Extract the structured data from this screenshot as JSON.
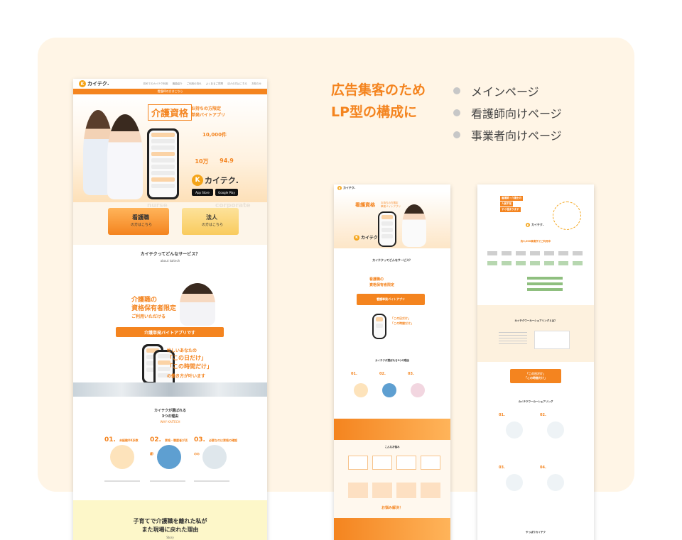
{
  "colors": {
    "accent": "#f4841f",
    "panel_bg": "#fff5e6",
    "bullet": "#c7c7c7"
  },
  "heading": {
    "line1": "広告集客のため",
    "line2": "LP型の構成に"
  },
  "bullets": [
    "メインページ",
    "看護師向けページ",
    "事業者向けページ"
  ],
  "main": {
    "logo": "カイテク.",
    "nav": [
      "初めてのカイテク利用",
      "機能紹介",
      "ご利用の流れ",
      "よくあるご質問",
      "法人の方はこちら",
      "お知らせ"
    ],
    "banner": "看護師の方はこちら",
    "hero_title": "介護資格",
    "hero_sub1": "お持ちの方限定",
    "hero_sub2": "単発バイトアプリ",
    "stat1_value": "10,000件",
    "stat2_value": "10万",
    "stat3_value": "94.9",
    "logo_big": "カイテク.",
    "store1": "App Store",
    "store2": "Google Play",
    "btn_nurse_title": "看護職",
    "btn_nurse_sub": "の方はこちら",
    "btn_nurse_bg": "nurse",
    "btn_corp_title": "法人",
    "btn_corp_sub": "の方はこちら",
    "btn_corp_bg": "corporate",
    "about_title": "カイテクってどんなサービス？",
    "about_en": "about kaitech",
    "about_line1": "介護職の",
    "about_line2": "資格保有者限定",
    "about_line3": "ご利用いただける",
    "about_bar": "介護単発バイトアプリです",
    "busy_line1": "忙しいあなたの",
    "busy_line2": "「この日だけ」",
    "busy_line3": "「この時間だけ」",
    "busy_line4": "の働き方が叶います",
    "reasons_title1": "カイテクが選ばれる",
    "reasons_title2": "3つの理由",
    "reasons_en": "WHY KAITECH",
    "reasons": [
      {
        "num": "01.",
        "label": "未経験OK多数"
      },
      {
        "num": "02.",
        "label": "資格・職歴者が活躍！"
      },
      {
        "num": "03.",
        "label": "必要なのは資格の確認のみ"
      }
    ],
    "story_line1": "子育てで介護職を離れた私が",
    "story_line2": "また現場に戻れた理由",
    "story_label": "Story"
  },
  "nurse": {
    "logo": "カイテク.",
    "hero_title": "看護資格",
    "hero_sub1": "お持ちの方限定",
    "hero_sub2": "単発バイトアプリ",
    "logo_big": "カイテク.",
    "about_title": "カイテクってどんなサービス？",
    "about_line1": "看護職の",
    "about_line2": "資格保有者限定",
    "about_bar": "看護単発バイトアプリ",
    "busy_line1": "「この日だけ」",
    "busy_line2": "「この時間だけ」",
    "reasons_title": "カイテクが選ばれる3つの理由",
    "reasons": [
      "01.",
      "02.",
      "03."
    ],
    "worries_title": "こんなお悩み",
    "worries_bottom": "お悩み解決！"
  },
  "corp": {
    "hero_line1": "看護師・介護士の",
    "hero_line2": "人員不足",
    "hero_line3": "すぐ埋まります",
    "logo": "カイテク.",
    "clients_title": "約3,000事業所でご利用中",
    "section_title": "カイテクワーカーシェアリングとは？",
    "cta_line1": "「この日だけ」",
    "cta_line2": "「この時間だけ」",
    "features_title": "カイテクワーカーシェアリング",
    "features": [
      "01.",
      "02.",
      "03.",
      "04."
    ],
    "footer_title": "やっぱりカイテク"
  }
}
